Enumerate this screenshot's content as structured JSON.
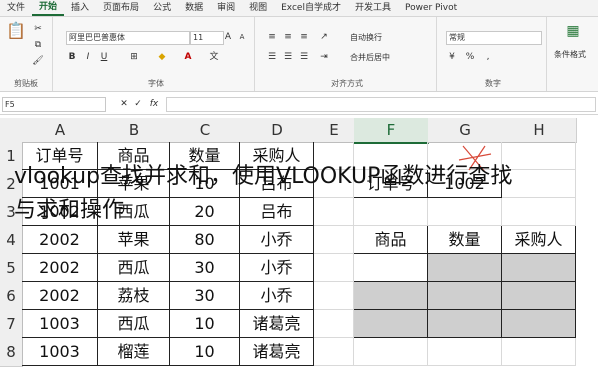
{
  "ribbon_tabs": [
    "文件",
    "开始",
    "插入",
    "页面布局",
    "公式",
    "数据",
    "审阅",
    "视图",
    "Excel自学成才",
    "开发工具",
    "Power Pivot"
  ],
  "active_tab_index": 1,
  "ribbon": {
    "clipboard": {
      "group_name": "剪贴板"
    },
    "font": {
      "font_name": "阿里巴巴普惠体",
      "font_size": "11",
      "group_name": "字体"
    },
    "alignment": {
      "wrap_text": "自动换行",
      "merge_center": "合并后居中",
      "group_name": "对齐方式"
    },
    "number": {
      "format": "常规",
      "group_name": "数字"
    },
    "styles": {
      "conditional_format": "条件格式"
    }
  },
  "formula_bar": {
    "name_box": "F5",
    "fx": "fx",
    "formula": ""
  },
  "columns": [
    "A",
    "B",
    "C",
    "D",
    "E",
    "F",
    "G",
    "H"
  ],
  "rows": [
    "1",
    "2",
    "3",
    "4",
    "5",
    "6",
    "7",
    "8"
  ],
  "table": [
    [
      "订单号",
      "商品",
      "数量",
      "采购人"
    ],
    [
      "1001",
      "苹果",
      "10",
      "吕布"
    ],
    [
      "1002",
      "西瓜",
      "20",
      "吕布"
    ],
    [
      "2002",
      "苹果",
      "80",
      "小乔"
    ],
    [
      "2002",
      "西瓜",
      "30",
      "小乔"
    ],
    [
      "2002",
      "荔枝",
      "30",
      "小乔"
    ],
    [
      "1003",
      "西瓜",
      "10",
      "诸葛亮"
    ],
    [
      "1003",
      "榴莲",
      "10",
      "诸葛亮"
    ]
  ],
  "lookup": {
    "key_label": "订单号",
    "key_value": "1002",
    "headers": [
      "商品",
      "数量",
      "采购人"
    ]
  },
  "overlay_title": {
    "line1": "vlookup查找并求和，使用VLOOKUP函数进行查找",
    "line2": "与求和操作"
  },
  "accent_color": "#1d6b37"
}
